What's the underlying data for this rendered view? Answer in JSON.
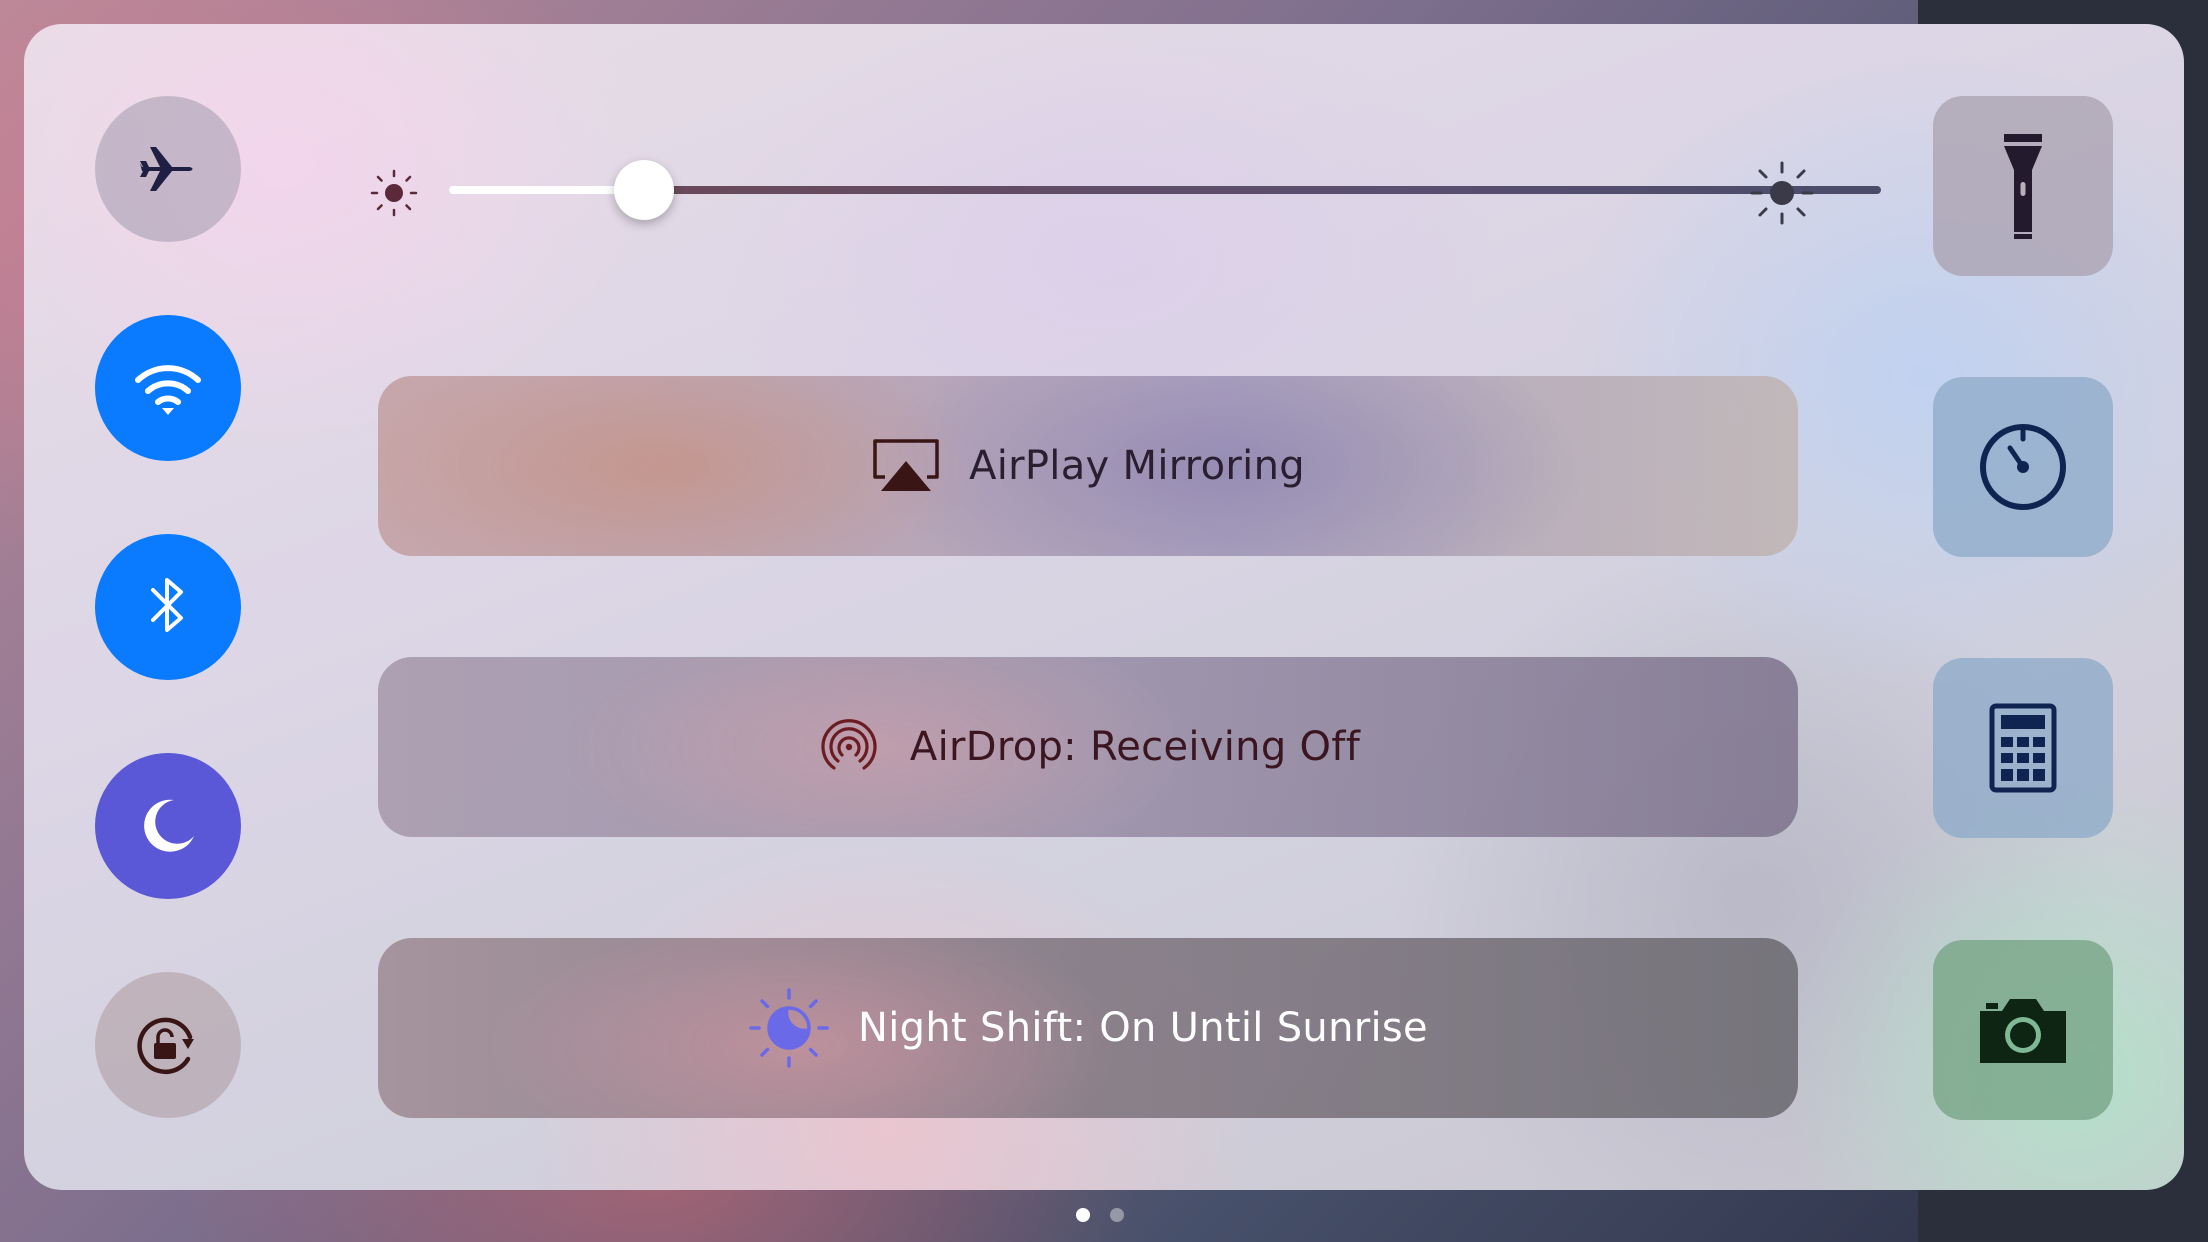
{
  "control_center": {
    "toggles": [
      {
        "name": "airplane-mode",
        "state": "off",
        "icon": "airplane-icon",
        "color": "#6b6d84"
      },
      {
        "name": "wifi",
        "state": "on",
        "icon": "wifi-icon",
        "color": "#0a7aff"
      },
      {
        "name": "bluetooth",
        "state": "on",
        "icon": "bluetooth-icon",
        "color": "#0a7aff"
      },
      {
        "name": "do-not-disturb",
        "state": "on",
        "icon": "moon-icon",
        "color": "#5b58d8"
      },
      {
        "name": "rotation-lock",
        "state": "off",
        "icon": "rotation-lock-icon",
        "color": "#9a7f7f"
      }
    ],
    "brightness": {
      "level": 0.16,
      "min_icon": "sun-dim-icon",
      "max_icon": "sun-bright-icon"
    },
    "airplay": {
      "label": "AirPlay Mirroring",
      "icon": "airplay-icon"
    },
    "airdrop": {
      "label": "AirDrop: Receiving Off",
      "icon": "airdrop-icon"
    },
    "night_shift": {
      "label": "Night Shift: On Until Sunrise",
      "icon": "night-shift-icon",
      "accent": "#5b58d8"
    },
    "shortcuts": [
      {
        "name": "flashlight",
        "icon": "flashlight-icon"
      },
      {
        "name": "timer",
        "icon": "timer-icon"
      },
      {
        "name": "calculator",
        "icon": "calculator-icon"
      },
      {
        "name": "camera",
        "icon": "camera-icon"
      }
    ],
    "pages": {
      "count": 2,
      "current": 1
    }
  }
}
